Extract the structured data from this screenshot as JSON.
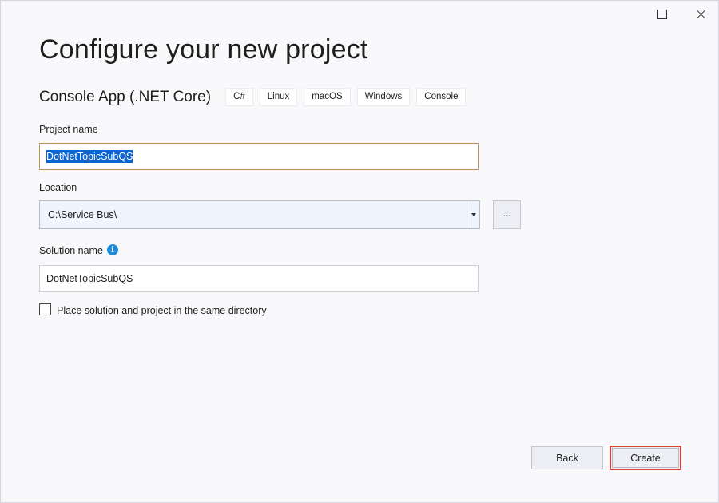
{
  "dialog": {
    "title": "Configure your new project",
    "template_name": "Console App (.NET Core)",
    "tags": [
      "C#",
      "Linux",
      "macOS",
      "Windows",
      "Console"
    ]
  },
  "project_name": {
    "label": "Project name",
    "value": "DotNetTopicSubQS"
  },
  "location": {
    "label": "Location",
    "value": "C:\\Service Bus\\",
    "browse_label": "..."
  },
  "solution_name": {
    "label": "Solution name",
    "value": "DotNetTopicSubQS",
    "info_icon": "info-icon"
  },
  "same_directory": {
    "label": "Place solution and project in the same directory",
    "checked": false
  },
  "footer": {
    "back_label": "Back",
    "create_label": "Create"
  },
  "colors": {
    "highlight_border": "#d9433b",
    "selection": "#0a64d2",
    "info": "#1d8ddb"
  }
}
